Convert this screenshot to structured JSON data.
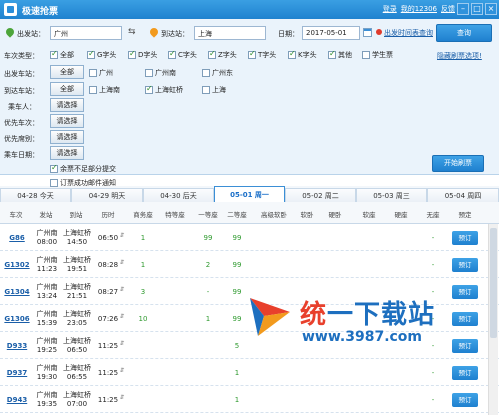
{
  "app": {
    "title": "极速抢票",
    "header_links": [
      "登录",
      "我的12306",
      "反馈"
    ],
    "window_buttons": [
      "–",
      "□",
      "×"
    ]
  },
  "search": {
    "from_label": "出发站：",
    "from_value": "广州",
    "to_label": "到达站：",
    "to_value": "上海",
    "date_label": "日期：",
    "date_value": "2017-05-01",
    "timetable_link": "出发时间表查询",
    "query_button": "查询",
    "hide_link": "隐藏刷票选项!"
  },
  "train_types": {
    "label": "车次类型：",
    "options": [
      {
        "label": "全部",
        "checked": true
      },
      {
        "label": "G字头",
        "checked": true
      },
      {
        "label": "D字头",
        "checked": true
      },
      {
        "label": "C字头",
        "checked": true
      },
      {
        "label": "Z字头",
        "checked": true
      },
      {
        "label": "T字头",
        "checked": true
      },
      {
        "label": "K字头",
        "checked": true
      },
      {
        "label": "其他",
        "checked": true
      },
      {
        "label": "学生票",
        "checked": false
      }
    ]
  },
  "depart_stations": {
    "label": "出发车站：",
    "button": "全部",
    "options": [
      {
        "label": "广州",
        "checked": false
      },
      {
        "label": "广州南",
        "checked": false
      },
      {
        "label": "广州东",
        "checked": false
      }
    ]
  },
  "arrive_stations": {
    "label": "到达车站：",
    "button": "全部",
    "options": [
      {
        "label": "上海南",
        "checked": false
      },
      {
        "label": "上海虹桥",
        "checked": true
      },
      {
        "label": "上海",
        "checked": false
      }
    ]
  },
  "passenger": {
    "label": "乘车人：",
    "button": "请选择"
  },
  "priority_trains": {
    "label": "优先车次：",
    "button": "请选择"
  },
  "priority_seats": {
    "label": "优先席别：",
    "button": "请选择"
  },
  "ride_dates": {
    "label": "乘车日期：",
    "button": "请选择"
  },
  "options": {
    "partial_submit": {
      "label": "余票不足部分提交",
      "checked": true
    },
    "notify_success": {
      "label": "订票成功邮件通知",
      "checked": false
    }
  },
  "start_button": "开始刷票",
  "date_tabs": [
    "04-28 今天",
    "04-29 明天",
    "04-30 后天",
    "05-01 周一",
    "05-02 周二",
    "05-03 周三",
    "05-04 周四"
  ],
  "active_tab_index": 3,
  "columns": [
    "车次",
    "发站",
    "到站",
    "历时",
    "商务座",
    "特等座",
    "一等座",
    "二等座",
    "高级软卧",
    "软卧",
    "硬卧",
    "软座",
    "硬座",
    "无座",
    "预定"
  ],
  "rows": [
    {
      "train": "G86",
      "from": "广州南",
      "from_time": "08:00",
      "to": "上海虹桥",
      "to_time": "14:50",
      "duration": "06:50",
      "business": "1",
      "special": "",
      "first": "99",
      "second": "99",
      "adv_soft": "",
      "soft": "",
      "hard": "",
      "soft_seat": "",
      "hard_seat": "",
      "no_seat": "-",
      "book": "预订"
    },
    {
      "train": "G1302",
      "from": "广州南",
      "from_time": "11:23",
      "to": "上海虹桥",
      "to_time": "19:51",
      "duration": "08:28",
      "business": "1",
      "special": "",
      "first": "2",
      "second": "99",
      "adv_soft": "",
      "soft": "",
      "hard": "",
      "soft_seat": "",
      "hard_seat": "",
      "no_seat": "-",
      "book": "预订"
    },
    {
      "train": "G1304",
      "from": "广州南",
      "from_time": "13:24",
      "to": "上海虹桥",
      "to_time": "21:51",
      "duration": "08:27",
      "business": "3",
      "special": "",
      "first": "-",
      "second": "99",
      "adv_soft": "",
      "soft": "",
      "hard": "",
      "soft_seat": "",
      "hard_seat": "",
      "no_seat": "-",
      "book": "预订"
    },
    {
      "train": "G1306",
      "from": "广州南",
      "from_time": "15:39",
      "to": "上海虹桥",
      "to_time": "23:05",
      "duration": "07:26",
      "business": "10",
      "special": "",
      "first": "1",
      "second": "99",
      "adv_soft": "",
      "soft": "",
      "hard": "",
      "soft_seat": "",
      "hard_seat": "",
      "no_seat": "-",
      "book": "预订"
    },
    {
      "train": "D933",
      "from": "广州南",
      "from_time": "19:25",
      "to": "上海虹桥",
      "to_time": "06:50",
      "duration": "11:25",
      "business": "",
      "special": "",
      "first": "",
      "second": "5",
      "adv_soft": "",
      "soft": "",
      "hard": "",
      "soft_seat": "",
      "hard_seat": "",
      "no_seat": "-",
      "book": "预订"
    },
    {
      "train": "D937",
      "from": "广州南",
      "from_time": "19:30",
      "to": "上海虹桥",
      "to_time": "06:55",
      "duration": "11:25",
      "business": "",
      "special": "",
      "first": "",
      "second": "1",
      "adv_soft": "",
      "soft": "",
      "hard": "",
      "soft_seat": "",
      "hard_seat": "",
      "no_seat": "-",
      "book": "预订"
    },
    {
      "train": "D943",
      "from": "广州南",
      "from_time": "19:35",
      "to": "上海虹桥",
      "to_time": "07:00",
      "duration": "11:25",
      "business": "",
      "special": "",
      "first": "",
      "second": "1",
      "adv_soft": "",
      "soft": "",
      "hard": "",
      "soft_seat": "",
      "hard_seat": "",
      "no_seat": "-",
      "book": "预订"
    }
  ],
  "watermark": {
    "line1_a": "统",
    "line1_b": "一下载站",
    "line2": "www.3987.com"
  },
  "colors": {
    "accent": "#1f82cf",
    "seat_available": "#2f9a2f",
    "train_link": "#1a5ea8"
  }
}
